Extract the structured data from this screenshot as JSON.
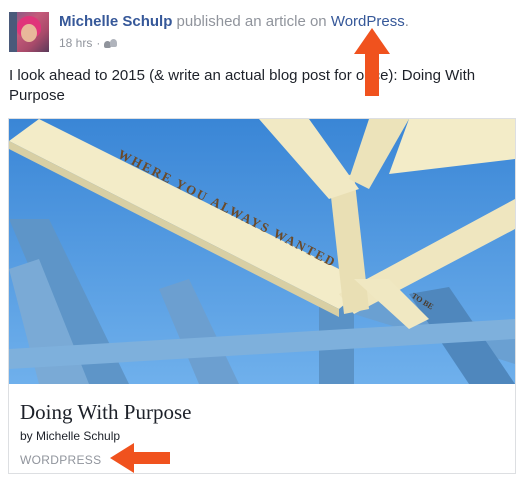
{
  "post": {
    "author": "Michelle Schulp",
    "action": "published an article on",
    "source": "WordPress",
    "source_period": ".",
    "time": "18 hrs",
    "separator": "·",
    "text": "I look ahead to 2015 (& write an actual blog post for once): Doing With Purpose"
  },
  "card": {
    "title": "Doing With Purpose",
    "byline": "by Michelle Schulp",
    "domain": "WORDPRESS",
    "image_text_1": "WHERE YOU ALWAYS WANTED",
    "image_text_2": "TO BE"
  },
  "icons": {
    "audience": "friends-icon",
    "clock": "clock-icon",
    "annotation": "red-arrow-icon"
  },
  "colors": {
    "link": "#365899",
    "meta": "#90949c",
    "arrow": "#f0521e",
    "sky": "#3f8fd8",
    "beam": "#f3ecc8"
  }
}
